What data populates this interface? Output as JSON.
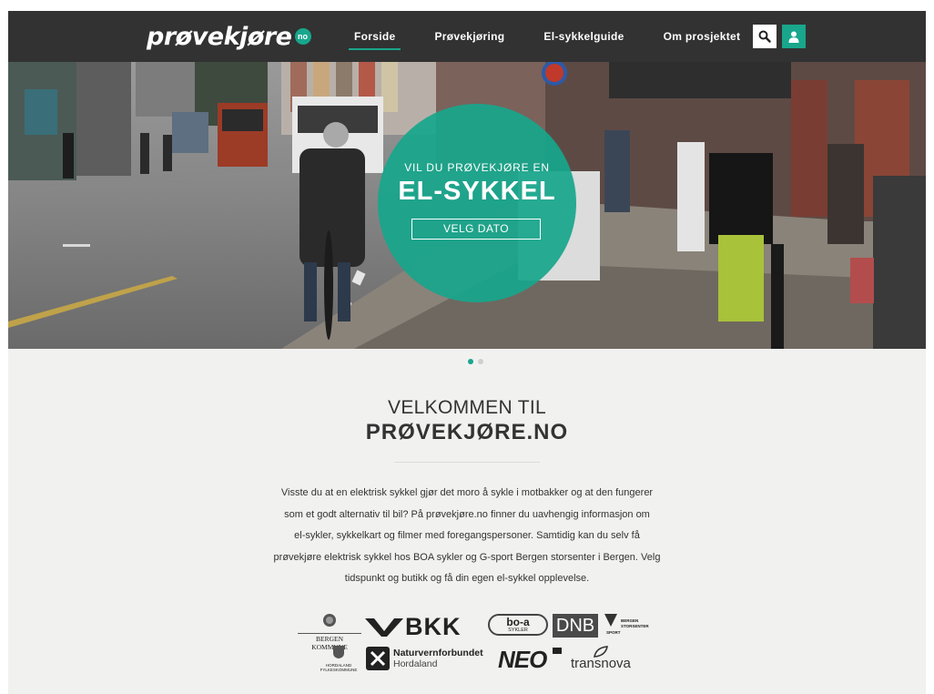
{
  "brand": {
    "logo_text": "prøvekjøre",
    "logo_suffix": "no",
    "accent_color": "#18a68c"
  },
  "nav": {
    "items": [
      {
        "label": "Forside",
        "active": true
      },
      {
        "label": "Prøvekjøring",
        "active": false
      },
      {
        "label": "El-sykkelguide",
        "active": false
      },
      {
        "label": "Om prosjektet",
        "active": false
      }
    ],
    "search_icon": "search-icon",
    "user_icon": "user-icon"
  },
  "hero": {
    "pretitle": "VIL DU PRØVEKJØRE EN",
    "title": "EL-SYKKEL",
    "button_label": "VELG DATO",
    "slide_count": 2,
    "active_slide": 1
  },
  "welcome": {
    "line1": "VELKOMMEN TIL",
    "line2": "PRØVEKJØRE.NO",
    "body": [
      "Visste du at en elektrisk sykkel gjør det moro å sykle i motbakker og at den fungerer",
      "som et godt alternativ til bil? På prøvekjøre.no finner du uavhengig informasjon om",
      "el-sykler, sykkelkart og filmer med foregangspersoner. Samtidig kan du selv få",
      "prøvekjøre elektrisk sykkel hos BOA sykler og G-sport Bergen storsenter i Bergen. Velg",
      "tidspunkt og butikk og få din egen el-sykkel opplevelse."
    ]
  },
  "sponsors": {
    "bergen_kommune": "BERGEN KOMMUNE",
    "bkk": "BKK",
    "boa": "bo-a",
    "boa_sub": "SYKLER",
    "dnb": "DNB",
    "bergen_storsenter_1": "BERGEN",
    "bergen_storsenter_2": "STORSENTER",
    "gsport": "SPORT",
    "hordaland_1": "HORDALAND",
    "hordaland_2": "FYLKESKOMMUNE",
    "naturvern_1": "Naturvernforbundet",
    "naturvern_2": "Hordaland",
    "neo": "NEO",
    "transnova": "transnova"
  }
}
